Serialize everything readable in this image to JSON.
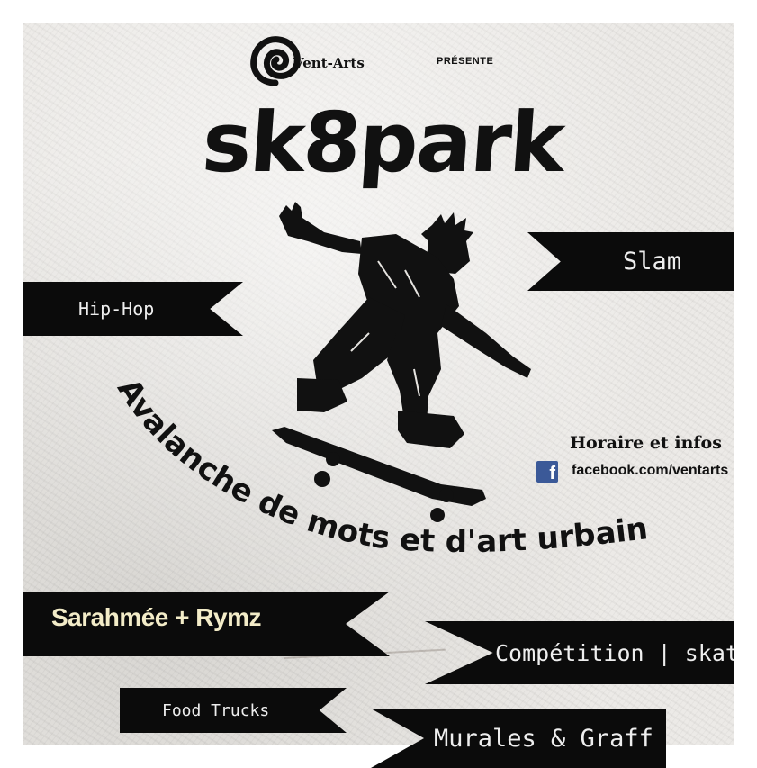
{
  "header": {
    "org_name": "Vent-Arts",
    "presents": "PRÉSENTE"
  },
  "title": "sk8park",
  "tagline": "Avalanche de mots et d'art urbain",
  "banners": {
    "hiphop": "Hip-Hop",
    "slam": "Slam",
    "artists": "Sarahmée + Rymz",
    "competition": "Compétition | skate",
    "food": "Food Trucks",
    "murals": "Murales & Graff"
  },
  "info": {
    "heading": "Horaire et infos",
    "facebook_letter": "f",
    "facebook_url": "facebook.com/ventarts"
  },
  "colors": {
    "banner": "#0b0b0b",
    "banner_text": "#eeeeee",
    "artists_text": "#f3ecc8",
    "facebook_blue": "#3b5998"
  }
}
